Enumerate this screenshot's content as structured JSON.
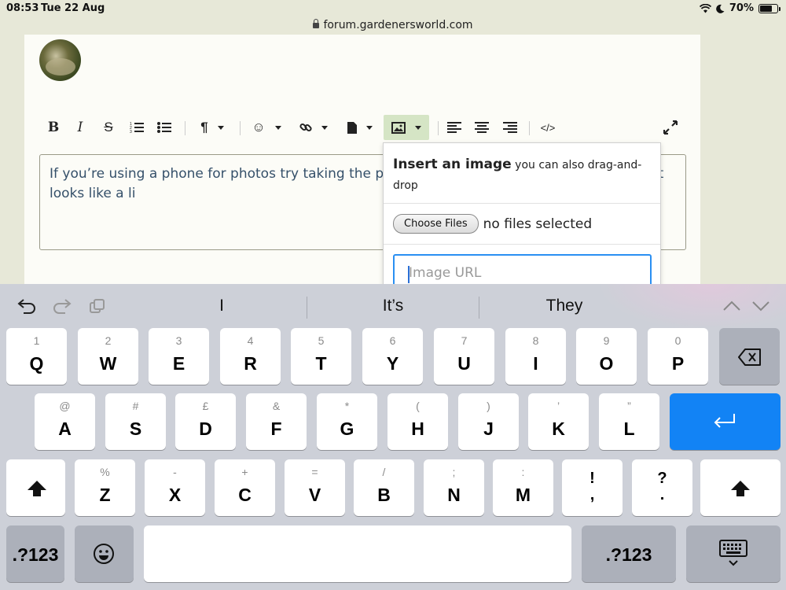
{
  "status_bar": {
    "time": "08:53",
    "date": "Tue 22 Aug",
    "battery": "70%",
    "battery_level": 0.7
  },
  "browser": {
    "url": "forum.gardenersworld.com"
  },
  "editor": {
    "text": "If you’re using a phone for photos try taking the photo in portrait then click on the icon that looks like a li",
    "toolbar": [
      "bold-icon",
      "italic-icon",
      "strikethrough-icon",
      "numbered-list-icon",
      "bullet-list-icon",
      "paragraph-icon",
      "emoji-icon",
      "link-icon",
      "file-icon",
      "image-icon",
      "align-left-icon",
      "align-center-icon",
      "align-right-icon",
      "code-icon",
      "fullscreen-icon"
    ]
  },
  "image_popup": {
    "title": "Insert an image",
    "subtitle": "you can also drag-and-drop",
    "choose_button": "Choose Files",
    "no_files": "no files selected",
    "url_placeholder": "Image URL"
  },
  "keyboard": {
    "suggestions": [
      "I",
      "It’s",
      "They"
    ],
    "row1": [
      [
        "1",
        "Q"
      ],
      [
        "2",
        "W"
      ],
      [
        "3",
        "E"
      ],
      [
        "4",
        "R"
      ],
      [
        "5",
        "T"
      ],
      [
        "6",
        "Y"
      ],
      [
        "7",
        "U"
      ],
      [
        "8",
        "I"
      ],
      [
        "9",
        "O"
      ],
      [
        "0",
        "P"
      ]
    ],
    "row2": [
      [
        "@",
        "A"
      ],
      [
        "#",
        "S"
      ],
      [
        "£",
        "D"
      ],
      [
        "&",
        "F"
      ],
      [
        "*",
        "G"
      ],
      [
        "(",
        "H"
      ],
      [
        ")",
        "J"
      ],
      [
        "’",
        "K"
      ],
      [
        "”",
        "L"
      ]
    ],
    "row3": [
      [
        "%",
        "Z"
      ],
      [
        "-",
        "X"
      ],
      [
        "+",
        "C"
      ],
      [
        "=",
        "V"
      ],
      [
        "/",
        "B"
      ],
      [
        ";",
        "N"
      ],
      [
        ":",
        "M"
      ]
    ],
    "row3_punct": [
      [
        "!",
        ","
      ],
      [
        "?",
        "."
      ]
    ],
    "numbers_label": ".?123",
    "accent_color": "#1283f5"
  }
}
